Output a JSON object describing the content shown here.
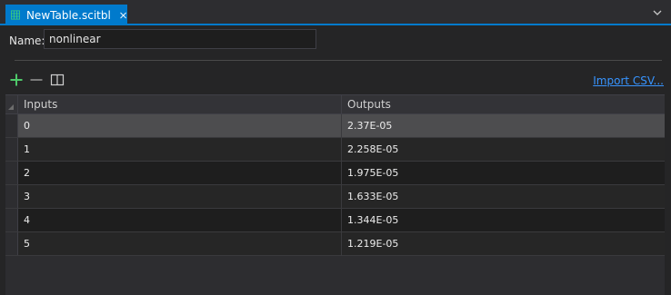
{
  "tab": {
    "title": "NewTable.scitbl",
    "icon": "table-icon",
    "close_icon": "close-icon",
    "accent": "#007acc"
  },
  "form": {
    "name_label": "Name:",
    "name_value": "nonlinear"
  },
  "toolbar": {
    "add_icon": "plus-icon",
    "remove_icon": "minus-icon",
    "columns_icon": "columns-icon",
    "import_label": "Import CSV..."
  },
  "table": {
    "columns": [
      "Inputs",
      "Outputs"
    ],
    "rows": [
      {
        "input": "0",
        "output": "2.37E-05"
      },
      {
        "input": "1",
        "output": "2.258E-05"
      },
      {
        "input": "2",
        "output": "1.975E-05"
      },
      {
        "input": "3",
        "output": "1.633E-05"
      },
      {
        "input": "4",
        "output": "1.344E-05"
      },
      {
        "input": "5",
        "output": "1.219E-05"
      }
    ],
    "selected_row": 0
  }
}
